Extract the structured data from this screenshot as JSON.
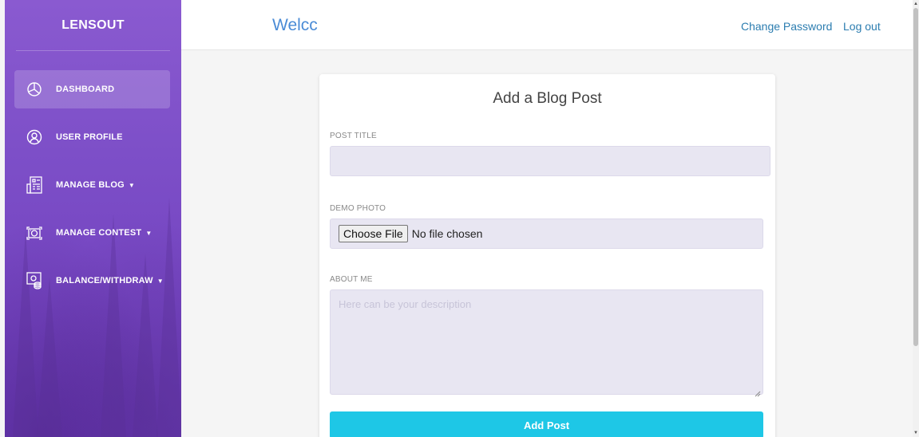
{
  "sidebar": {
    "brand": "LENSOUT",
    "items": [
      {
        "label": "DASHBOARD",
        "icon": "pie-chart-icon",
        "active": true,
        "has_caret": false
      },
      {
        "label": "USER PROFILE",
        "icon": "user-circle-icon",
        "active": false,
        "has_caret": false
      },
      {
        "label": "MANAGE BLOG",
        "icon": "blog-grid-icon",
        "active": false,
        "has_caret": true
      },
      {
        "label": "MANAGE CONTEST",
        "icon": "camera-icon",
        "active": false,
        "has_caret": true
      },
      {
        "label": "BALANCE/WITHDRAW",
        "icon": "wallet-coins-icon",
        "active": false,
        "has_caret": true
      }
    ],
    "caret": "▼"
  },
  "header": {
    "welcome": "Welcc",
    "change_password": "Change Password",
    "logout": "Log out"
  },
  "form": {
    "title": "Add a Blog Post",
    "post_title_label": "POST TITLE",
    "post_title_value": "",
    "demo_photo_label": "DEMO PHOTO",
    "choose_file": "Choose File",
    "no_file": "No file chosen",
    "about_label": "ABOUT ME",
    "about_placeholder": "Here can be your description",
    "submit": "Add Post"
  },
  "colors": {
    "sidebar_top": "#8a5ad0",
    "sidebar_bottom": "#6a3bb6",
    "link": "#2c7db0",
    "welcome": "#4a8bd6",
    "button": "#1ec7e6"
  }
}
